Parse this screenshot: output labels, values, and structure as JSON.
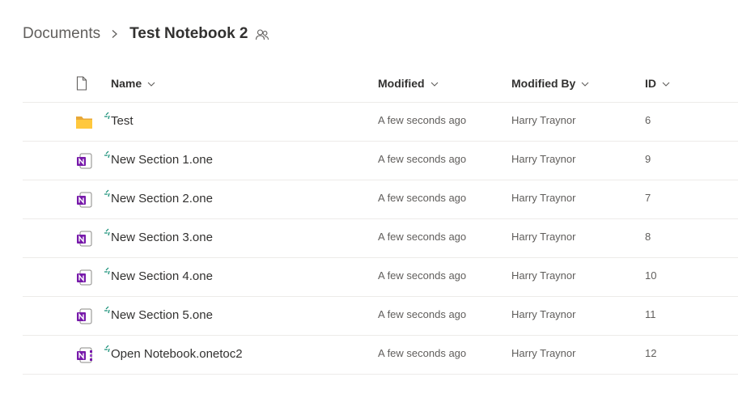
{
  "breadcrumb": {
    "root": "Documents",
    "current": "Test Notebook 2",
    "separator_icon": "chevron-right-icon",
    "shared_icon": "people-icon"
  },
  "columns": {
    "type_icon": "document-icon",
    "name": "Name",
    "modified": "Modified",
    "modified_by": "Modified By",
    "id": "ID"
  },
  "rows": [
    {
      "icon": "folder-icon",
      "name": "Test",
      "modified": "A few seconds ago",
      "modified_by": "Harry Traynor",
      "id": "6"
    },
    {
      "icon": "onenote-section-icon",
      "name": "New Section 1.one",
      "modified": "A few seconds ago",
      "modified_by": "Harry Traynor",
      "id": "9"
    },
    {
      "icon": "onenote-section-icon",
      "name": "New Section 2.one",
      "modified": "A few seconds ago",
      "modified_by": "Harry Traynor",
      "id": "7"
    },
    {
      "icon": "onenote-section-icon",
      "name": "New Section 3.one",
      "modified": "A few seconds ago",
      "modified_by": "Harry Traynor",
      "id": "8"
    },
    {
      "icon": "onenote-section-icon",
      "name": "New Section 4.one",
      "modified": "A few seconds ago",
      "modified_by": "Harry Traynor",
      "id": "10"
    },
    {
      "icon": "onenote-section-icon",
      "name": "New Section 5.one",
      "modified": "A few seconds ago",
      "modified_by": "Harry Traynor",
      "id": "11"
    },
    {
      "icon": "onenote-notebook-icon",
      "name": "Open Notebook.onetoc2",
      "modified": "A few seconds ago",
      "modified_by": "Harry Traynor",
      "id": "12"
    }
  ],
  "colors": {
    "onenote_purple": "#7719aa",
    "folder_yellow": "#ffc83d",
    "new_item_green": "#0b8a71"
  }
}
